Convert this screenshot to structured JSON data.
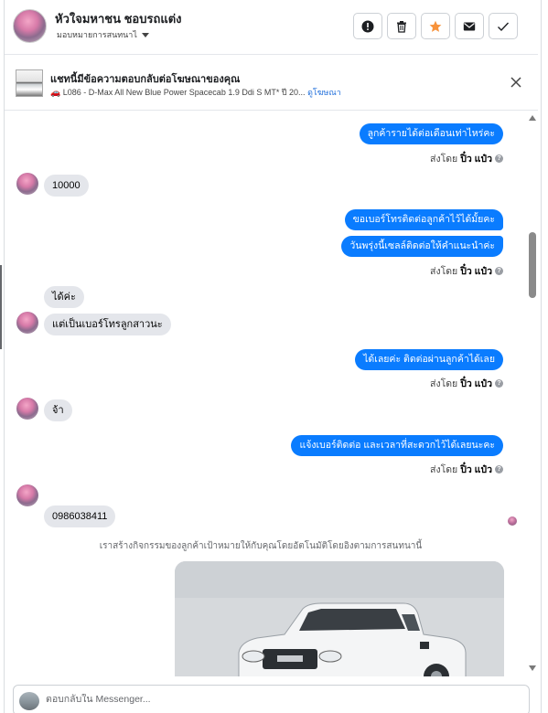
{
  "header": {
    "title": "หัวใจมหาชน ชอบรถแต่ง",
    "assign_label": "มอบหมายการสนทนาไ"
  },
  "ad": {
    "title": "แชทนี้มีข้อความตอบกลับต่อโฆษณาของคุณ",
    "subtitle": "L086 - D-Max All New Blue Power Spacecab 1.9 Ddi S MT* ปี 20...",
    "link": "ดูโฆษณา"
  },
  "messages": {
    "m1": "ลูกค้ารายได้ต่อเดือนเท่าไหร่คะ",
    "m2": "10000",
    "m3": "ขอเบอร์โทรติดต่อลูกค้าไว้ได้มั้ยคะ",
    "m4": "วันพรุ่งนี้เซลล์ติดต่อให้คำแนะนำค่ะ",
    "m5": "ได้ค่ะ",
    "m6": "แต่เป็นเบอร์โทรลูกสาวนะ",
    "m7": "ได้เลยค่ะ ติดต่อผ่านลูกค้าได้เลย",
    "m8": "จ้า",
    "m9": "แจ้งเบอร์ติดต่อ และเวลาที่สะดวกไว้ได้เลยนะคะ",
    "m10": "0986038411"
  },
  "sent_by": {
    "prefix": "ส่งโดย",
    "name": "ปิ๋ว แป๋ว"
  },
  "system_note": "เราสร้างกิจกรรมของลูกค้าเป้าหมายให้กับคุณโดยอัตโนมัติโดยอิงตามการสนทนานี้",
  "composer": {
    "placeholder": "ตอบกลับใน Messenger..."
  }
}
